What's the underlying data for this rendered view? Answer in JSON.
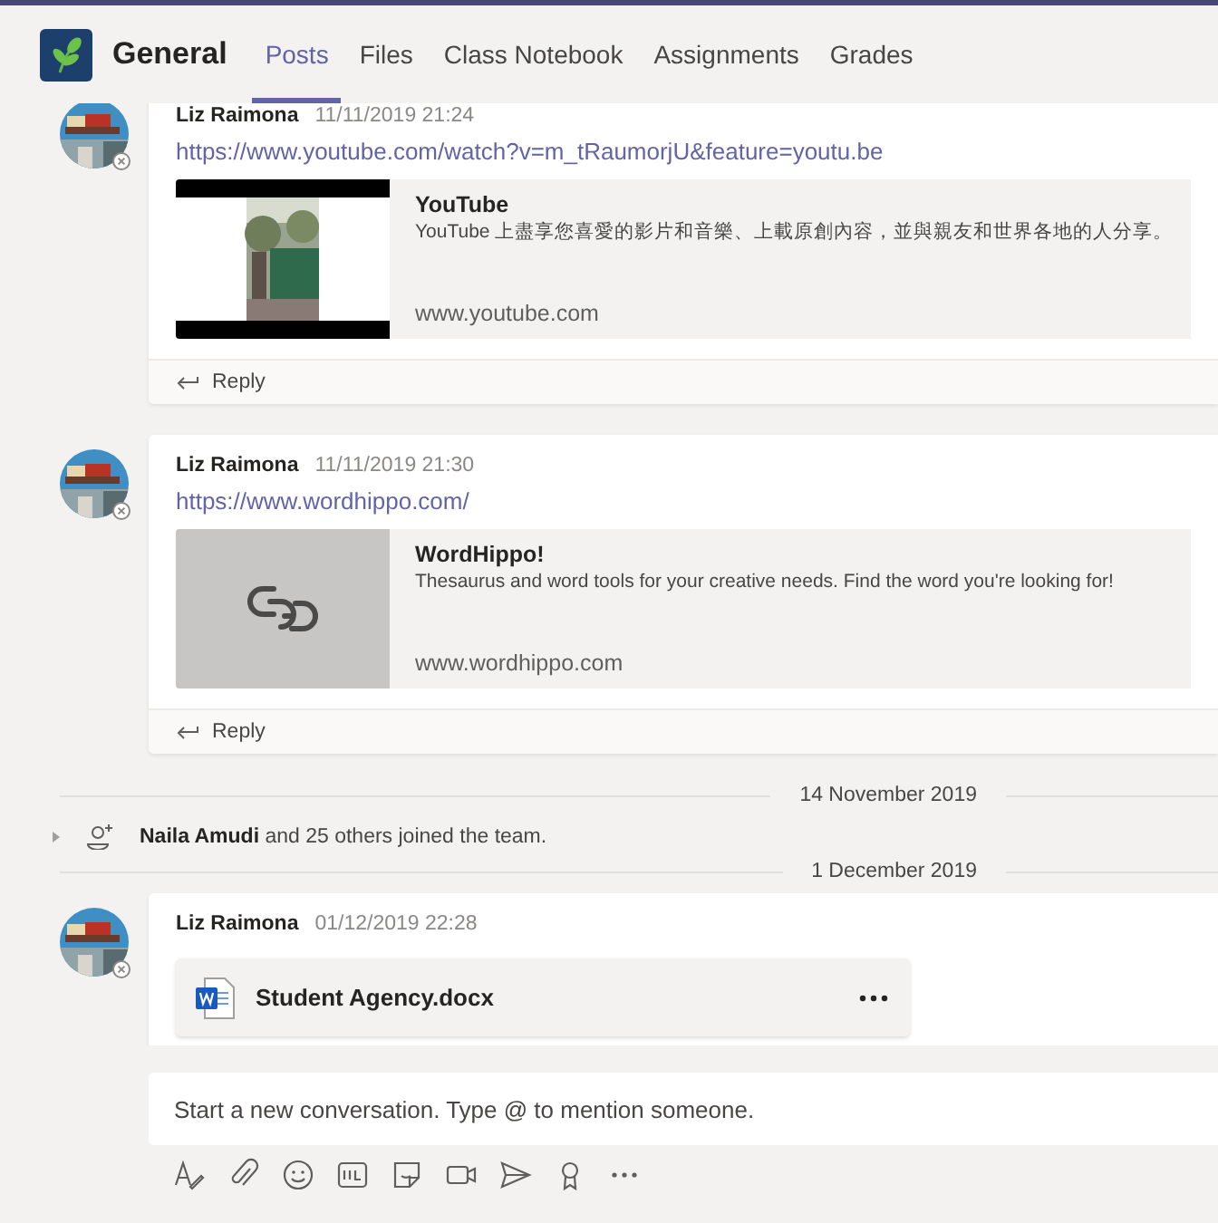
{
  "header": {
    "team_name": "General",
    "tabs": [
      {
        "label": "Posts",
        "selected": true
      },
      {
        "label": "Files",
        "selected": false
      },
      {
        "label": "Class Notebook",
        "selected": false
      },
      {
        "label": "Assignments",
        "selected": false
      },
      {
        "label": "Grades",
        "selected": false
      }
    ]
  },
  "feed": [
    {
      "kind": "post",
      "author": "Liz Raimona",
      "time": "11/11/2019 21:24",
      "link": "https://www.youtube.com/watch?v=m_tRaumorjU&feature=youtu.be",
      "preview": {
        "kind": "picture",
        "title": "YouTube",
        "description": "YouTube 上盡享您喜愛的影片和音樂、上載原創內容，並與親友和世界各地的人分享。",
        "domain": "www.youtube.com"
      },
      "reply": "Reply"
    },
    {
      "kind": "post",
      "author": "Liz Raimona",
      "time": "11/11/2019 21:30",
      "link": "https://www.wordhippo.com/",
      "preview": {
        "kind": "link",
        "title": "WordHippo!",
        "description": "Thesaurus and word tools for your creative needs. Find the word you're looking for!",
        "domain": "www.wordhippo.com"
      },
      "reply": "Reply"
    },
    {
      "kind": "divider",
      "label": "14 November 2019"
    },
    {
      "kind": "system",
      "text": "**Naila Amudi** and 25 others joined the team."
    },
    {
      "kind": "divider",
      "label": "1 December 2019"
    },
    {
      "kind": "post",
      "author": "Liz Raimona",
      "time": "01/12/2019 22:28",
      "file": {
        "name": "Student Agency.docx"
      }
    }
  ],
  "compose": {
    "placeholder": "Start a new conversation. Type @ to mention someone."
  }
}
